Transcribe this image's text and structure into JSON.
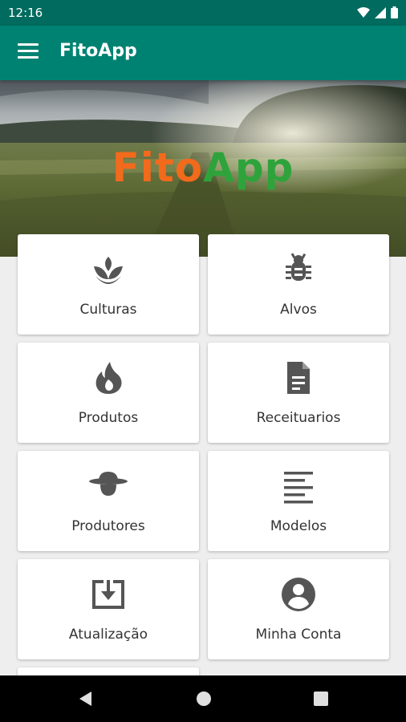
{
  "status": {
    "time": "12:16"
  },
  "app_bar": {
    "title": "FitoApp"
  },
  "hero": {
    "logo_part1": "Fito",
    "logo_part2": "App"
  },
  "menu": [
    {
      "label": "Culturas",
      "icon": "sprout-icon"
    },
    {
      "label": "Alvos",
      "icon": "bug-icon"
    },
    {
      "label": "Produtos",
      "icon": "flame-icon"
    },
    {
      "label": "Receituarios",
      "icon": "document-icon"
    },
    {
      "label": "Produtores",
      "icon": "farmer-hat-icon"
    },
    {
      "label": "Modelos",
      "icon": "text-lines-icon"
    },
    {
      "label": "Atualização",
      "icon": "download-box-icon"
    },
    {
      "label": "Minha Conta",
      "icon": "account-circle-icon"
    }
  ],
  "colors": {
    "status_bar": "#006b5e",
    "app_bar": "#008272",
    "icon": "#555555",
    "logo_fito": "#f26a1b",
    "logo_app": "#2fa33b"
  }
}
